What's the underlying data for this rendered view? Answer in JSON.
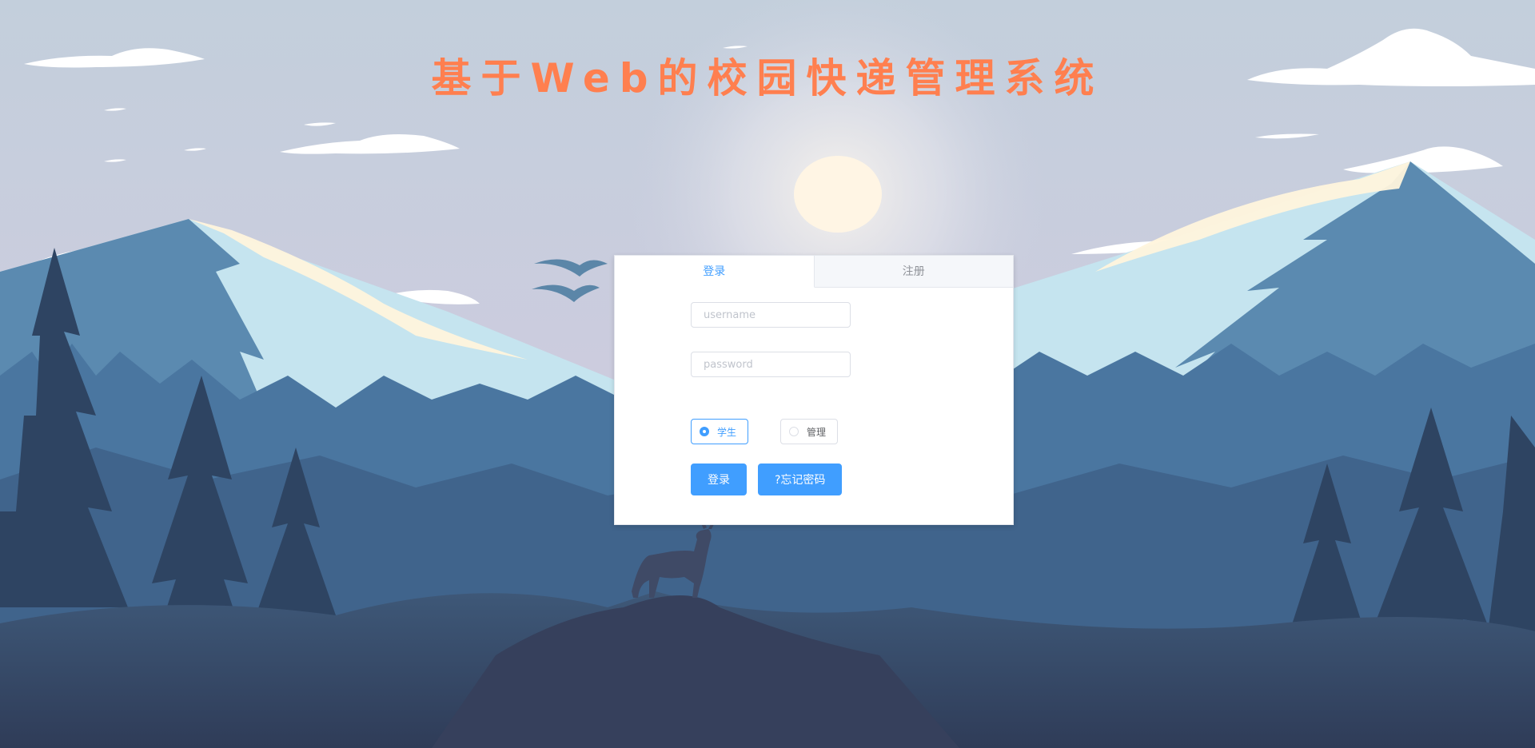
{
  "app": {
    "title": "基于Web的校园快递管理系统"
  },
  "login_card": {
    "tabs": [
      {
        "label": "登录",
        "active": true
      },
      {
        "label": "注册",
        "active": false
      }
    ],
    "username": {
      "placeholder": "username",
      "value": ""
    },
    "password": {
      "placeholder": "password",
      "value": ""
    },
    "roles": [
      {
        "label": "学生",
        "checked": true
      },
      {
        "label": "管理",
        "checked": false
      }
    ],
    "login_button": "登录",
    "forgot_button": "?忘记密码"
  },
  "colors": {
    "title": "#ff7f4f",
    "primary": "#409eff"
  }
}
